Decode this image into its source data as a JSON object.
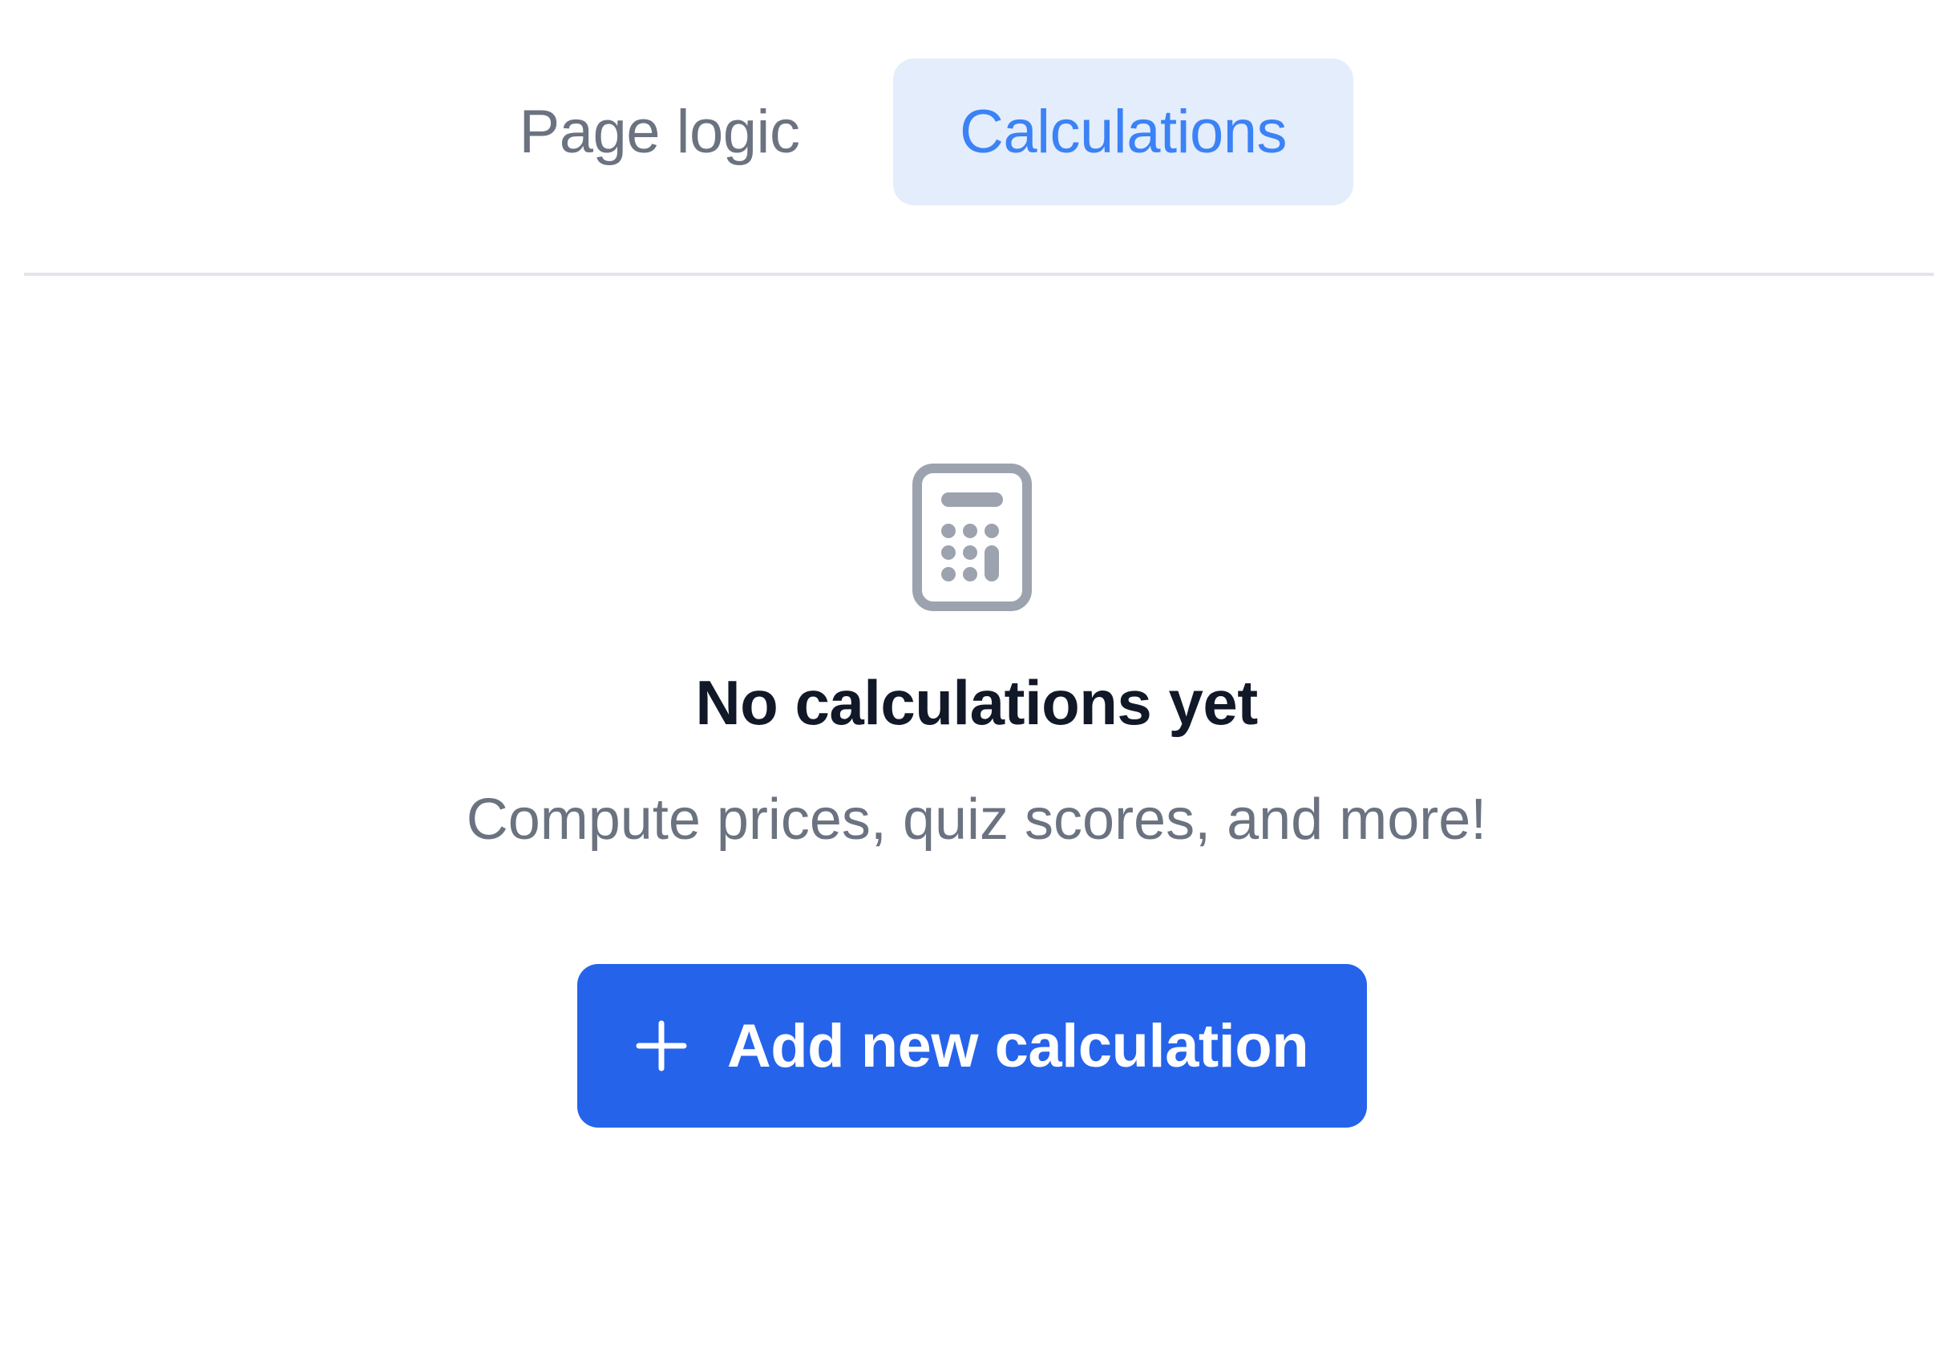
{
  "tabs": [
    {
      "label": "Page logic",
      "active": false
    },
    {
      "label": "Calculations",
      "active": true
    }
  ],
  "empty_state": {
    "icon": "calculator-icon",
    "title": "No calculations yet",
    "subtitle": "Compute prices, quiz scores, and more!"
  },
  "primary_action": {
    "icon": "plus-icon",
    "label": "Add new calculation"
  },
  "colors": {
    "accent": "#2563eb",
    "active_tab_text": "#3b82f6",
    "active_tab_bg": "#e4edfb",
    "muted_text": "#6b7280",
    "heading_text": "#111827",
    "icon_gray": "#9ca3af",
    "divider": "#e2e4ea"
  }
}
